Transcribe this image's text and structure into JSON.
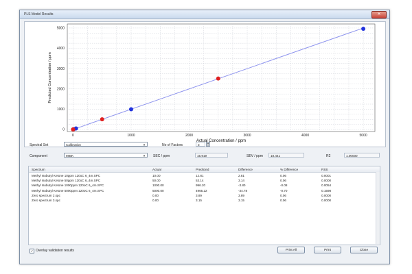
{
  "window": {
    "title": "PLS Model Results",
    "close_label": "✕"
  },
  "chart_data": {
    "type": "scatter",
    "title": "",
    "xlabel": "Actual Concentration / ppm",
    "ylabel": "Predicted Concentration / ppm",
    "xlim": [
      -100,
      5200
    ],
    "ylim": [
      -100,
      5200
    ],
    "xticks": [
      0,
      1000,
      2000,
      3000,
      4000,
      5000
    ],
    "yticks": [
      0,
      1000,
      2000,
      3000,
      4000,
      5000
    ],
    "grid": true,
    "line": {
      "x": [
        0,
        5000
      ],
      "y": [
        0,
        5000
      ],
      "color": "#8f95ee"
    },
    "series": [
      {
        "color": "#2233dd",
        "x": [
          10,
          50,
          1000,
          5000
        ],
        "y": [
          12.81,
          53.14,
          996.2,
          4965.22
        ]
      },
      {
        "color": "#e02020",
        "x": [
          0,
          0,
          500,
          2500
        ],
        "y": [
          3.89,
          3.15,
          505,
          2510
        ]
      }
    ]
  },
  "controls": {
    "spectral_set_label": "Spectral Set",
    "spectral_set_value": "Calibration",
    "component_label": "Component",
    "component_value": "MIBK",
    "factors_label": "No of Factors",
    "factors_value": "3",
    "sec_label": "SEC / ppm",
    "sec_value": "15.919",
    "sev_label": "SEV / ppm",
    "sev_value": "18.441",
    "r2_label": "R2",
    "r2_value": "1.00000"
  },
  "table": {
    "headers": [
      "Spectrum",
      "Actual",
      "Predicted",
      "Difference",
      "% Difference",
      "RSS"
    ],
    "rows": [
      [
        "Methyl Isobutyl Ketone 10ppm 120oC 6_4m.SPC",
        "10.00",
        "12.81",
        "2.81",
        "0.06",
        "0.0001"
      ],
      [
        "Methyl Isobutyl Ketone 50ppm 120oC 6_4m.SPC",
        "50.00",
        "53.14",
        "3.14",
        "0.06",
        "0.0000"
      ],
      [
        "Methyl Isobutyl Ketone 1000ppm 120oC 6_4m.SPC",
        "1000.00",
        "996.20",
        "-3.80",
        "-0.08",
        "0.0054"
      ],
      [
        "Methyl Isobutyl Ketone 5000ppm 120oC 6_4m.SPC",
        "5000.00",
        "4965.22",
        "-34.78",
        "-0.70",
        "0.1598"
      ],
      [
        "Zero spectrum 2.spc",
        "0.00",
        "3.89",
        "3.89",
        "0.06",
        "0.0000"
      ],
      [
        "Zero spectrum 3.spc",
        "0.00",
        "3.15",
        "3.15",
        "0.06",
        "0.0000"
      ]
    ]
  },
  "footer": {
    "overlay_label": "Overlay validation results",
    "overlay_checked": "✓",
    "print_all": "Print All",
    "print": "Print",
    "close": "Close"
  }
}
